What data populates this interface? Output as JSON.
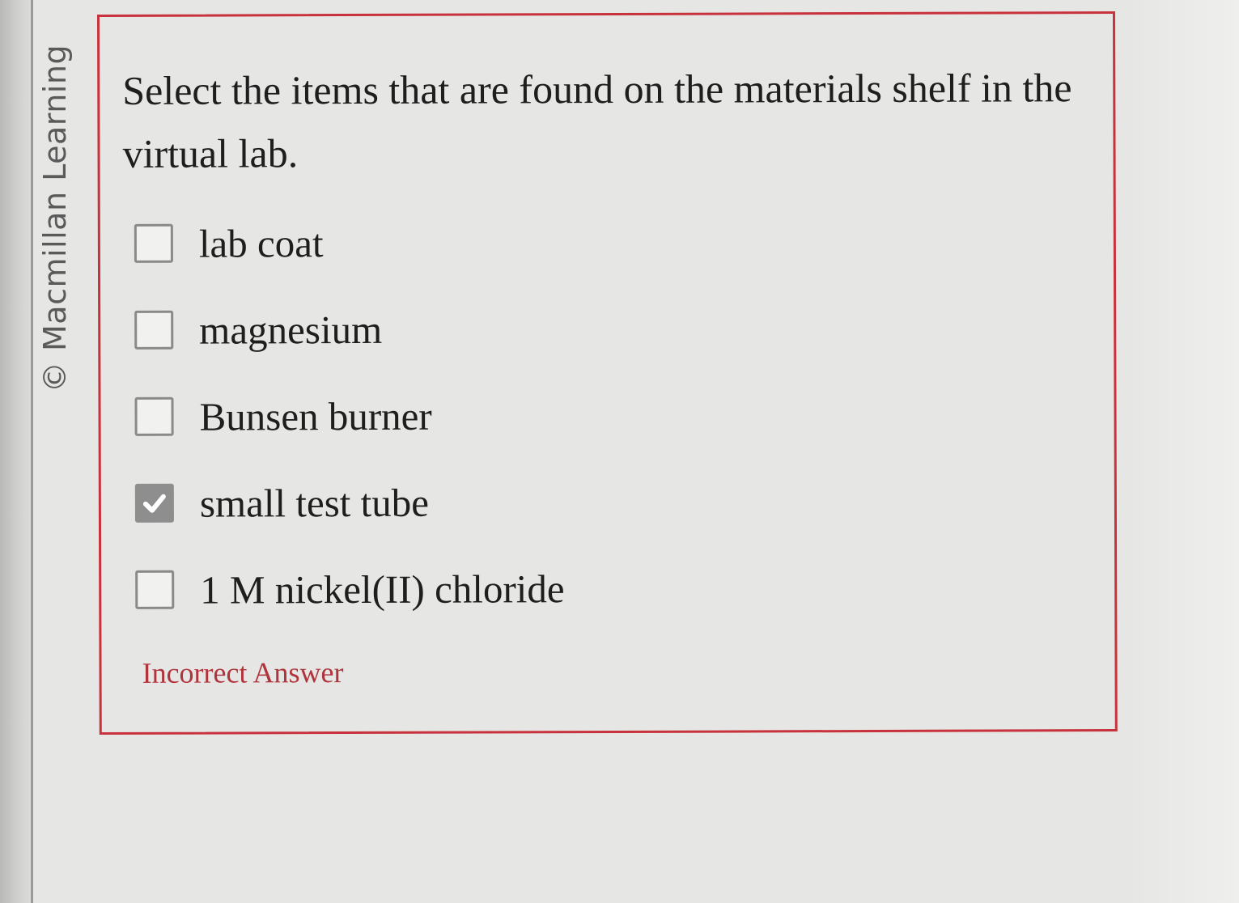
{
  "watermark": {
    "text": "© Macmillan Learning"
  },
  "question": {
    "prompt": "Select the items that are found on the materials shelf in the virtual lab.",
    "options": [
      {
        "label": "lab coat",
        "checked": false
      },
      {
        "label": "magnesium",
        "checked": false
      },
      {
        "label": "Bunsen burner",
        "checked": false
      },
      {
        "label": "small test tube",
        "checked": true
      },
      {
        "label": "1 M nickel(II) chloride",
        "checked": false
      }
    ],
    "feedback": "Incorrect Answer"
  },
  "colors": {
    "card_border": "#c8323c",
    "feedback_text": "#b0343c",
    "checked_fill": "#8e8e8e",
    "background": "#e6e6e4"
  },
  "icons": {
    "checked": "checkmark-icon"
  }
}
